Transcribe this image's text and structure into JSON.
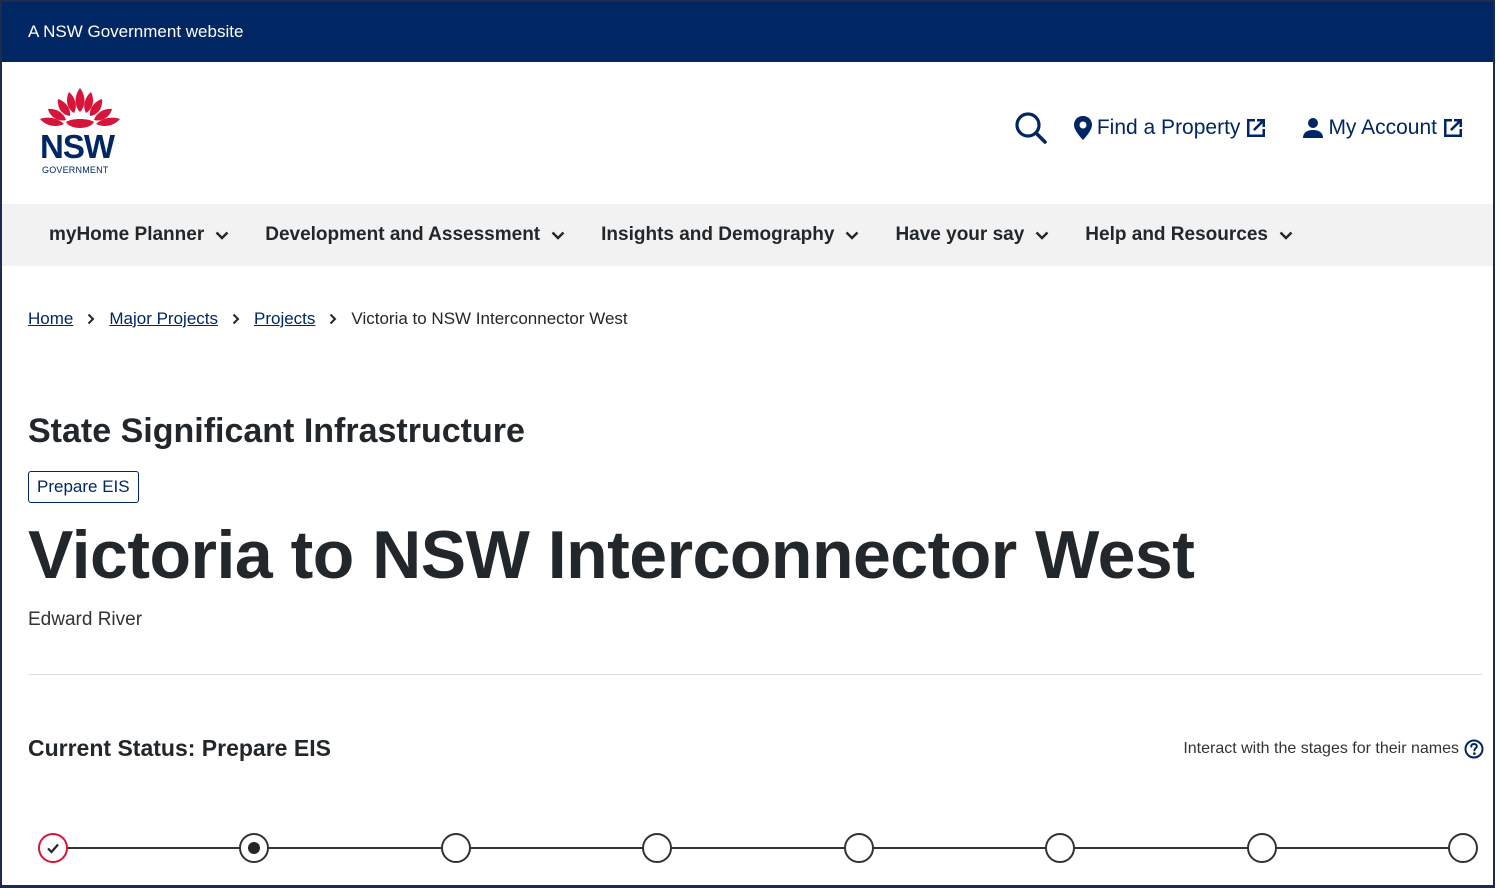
{
  "masthead": {
    "text": "A NSW Government website"
  },
  "logo": {
    "wordmark": "NSW",
    "subtitle": "GOVERNMENT",
    "color": "#d7153a"
  },
  "header": {
    "search_icon": "search-icon",
    "find_property": "Find a Property",
    "my_account": "My Account"
  },
  "nav": {
    "items": [
      {
        "label": "myHome Planner"
      },
      {
        "label": "Development and Assessment"
      },
      {
        "label": "Insights and Demography"
      },
      {
        "label": "Have your say"
      },
      {
        "label": "Help and Resources"
      }
    ]
  },
  "breadcrumb": {
    "home": "Home",
    "major_projects": "Major Projects",
    "projects": "Projects",
    "current": "Victoria to NSW Interconnector West"
  },
  "project": {
    "category": "State Significant Infrastructure",
    "stage_badge": "Prepare EIS",
    "title": "Victoria to NSW Interconnector West",
    "lga": "Edward River"
  },
  "status": {
    "label": "Current Status: Prepare EIS",
    "hint": "Interact with the stages for their names",
    "stages": [
      "done",
      "current",
      "pending",
      "pending",
      "pending",
      "pending",
      "pending",
      "pending"
    ]
  },
  "colors": {
    "navy": "#002664",
    "red": "#d7153a",
    "nav_bg": "#f2f2f2",
    "text": "#22272b"
  }
}
